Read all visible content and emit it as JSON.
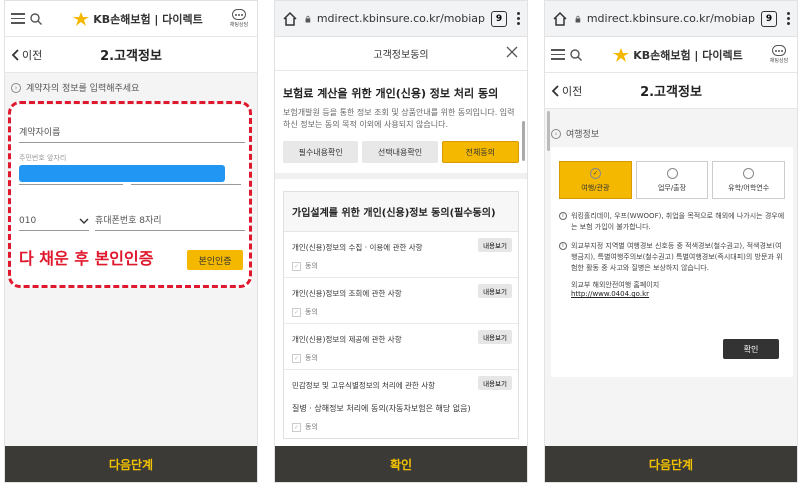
{
  "panel1": {
    "header": {
      "logo_text": "KB손해보험 | 다이렉트",
      "chatbot_label": "채팅상담"
    },
    "titlebar": {
      "back_label": "이전",
      "title": "2.고객정보"
    },
    "note": "계약자의 정보를 입력해주세요",
    "form": {
      "name_placeholder": "계약자이름",
      "id_label": "주민번호 앞자리",
      "carrier_value": "010",
      "phone_placeholder": "휴대폰번호 8자리",
      "verify_button": "본인인증"
    },
    "annotation": "다 채운 후 본인인증",
    "bottom_button": "다음단계"
  },
  "panel2": {
    "url": "mdirect.kbinsure.co.kr/mobiap",
    "tab_count": "9",
    "modal_title": "고객정보동의",
    "heading": "보험료 계산을 위한 개인(신용) 정보 처리 동의",
    "desc": "보험개발원 등을 통한 정보 조회 및 상품안내를 위한 동의입니다. 입력하신 정보는 동의 목적 이외에 사용되지 않습니다.",
    "segments": [
      "필수내용확인",
      "선택내용확인",
      "전체동의"
    ],
    "consent_heading": "가입설계를 위한 개인(신용)정보 동의(필수동의)",
    "items": [
      {
        "name": "개인(신용)정보의 수집 · 이용에 관한 사항",
        "view": "내용보기",
        "agree": "동의"
      },
      {
        "name": "개인(신용)정보의 조회에 관한 사항",
        "view": "내용보기",
        "agree": "동의"
      },
      {
        "name": "개인(신용)정보의 제공에 관한 사항",
        "view": "내용보기",
        "agree": "동의"
      },
      {
        "name": "민감정보 및 고유식별정보의 처리에 관한 사항",
        "view": "내용보기",
        "agree": ""
      }
    ],
    "extra_line": "질병 · 상해정보 처리에 동의(자동차보험은 해당 없음)",
    "extra_agree": "동의",
    "bottom_button": "확인"
  },
  "panel3": {
    "url": "mdirect.kbinsure.co.kr/mobiap",
    "tab_count": "9",
    "header": {
      "logo_text": "KB손해보험 | 다이렉트",
      "chatbot_label": "채팅상담"
    },
    "titlebar": {
      "back_label": "이전",
      "title": "2.고객정보"
    },
    "section": "여행정보",
    "options": [
      "여행/관광",
      "업무/출장",
      "유학/어학연수"
    ],
    "info1": "워킹홀리데이, 우프(WWOOF), 취업을 목적으로 해외에 나가시는 경우에는 보험 가입이 불가합니다.",
    "info2": "외교부지정 지역별 여행경보 신호등 중 적색경보(철수권고), 적색경보(여행금지), 특별여행주의보(철수권고) 특별여행경보(즉시대피)의 방문과 위험한 활동 중 사고와 질병은 보상하지 않습니다.",
    "link_label": "외교부 해외안전여행 홈페이지",
    "link_url": "http://www.0404.go.kr",
    "confirm_button": "확인",
    "bottom_button": "다음단계"
  },
  "colors": {
    "accent_yellow": "#f5b800",
    "annotation_red": "#e0182d",
    "bottom_bar": "#3c3a36"
  }
}
